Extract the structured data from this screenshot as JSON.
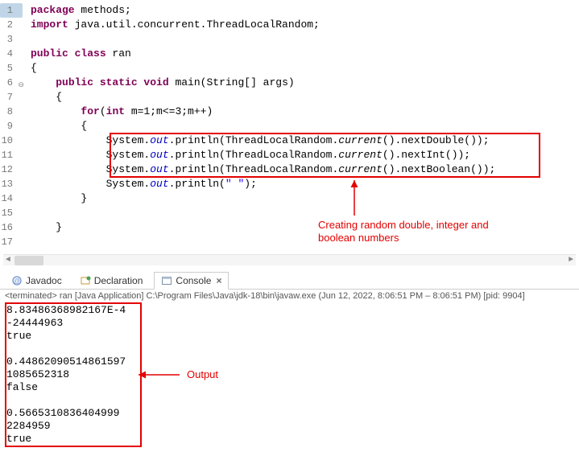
{
  "editor": {
    "lines": [
      {
        "num": "1",
        "tokens": [
          {
            "t": "package",
            "c": "kw"
          },
          {
            "t": " methods;",
            "c": ""
          }
        ]
      },
      {
        "num": "2",
        "tokens": [
          {
            "t": "import",
            "c": "kw"
          },
          {
            "t": " java.util.concurrent.ThreadLocalRandom;",
            "c": ""
          }
        ]
      },
      {
        "num": "3",
        "tokens": []
      },
      {
        "num": "4",
        "tokens": [
          {
            "t": "public class",
            "c": "kw"
          },
          {
            "t": " ran",
            "c": ""
          }
        ]
      },
      {
        "num": "5",
        "tokens": [
          {
            "t": "{",
            "c": ""
          }
        ]
      },
      {
        "num": "6",
        "fold": true,
        "tokens": [
          {
            "t": "    ",
            "c": ""
          },
          {
            "t": "public static void",
            "c": "kw"
          },
          {
            "t": " main(String[] args)",
            "c": ""
          }
        ]
      },
      {
        "num": "7",
        "tokens": [
          {
            "t": "    {",
            "c": ""
          }
        ]
      },
      {
        "num": "8",
        "tokens": [
          {
            "t": "        ",
            "c": ""
          },
          {
            "t": "for",
            "c": "kw"
          },
          {
            "t": "(",
            "c": ""
          },
          {
            "t": "int",
            "c": "kw"
          },
          {
            "t": " m=1;m<=3;m++)",
            "c": ""
          }
        ]
      },
      {
        "num": "9",
        "tokens": [
          {
            "t": "        {",
            "c": ""
          }
        ]
      },
      {
        "num": "10",
        "tokens": [
          {
            "t": "            System.",
            "c": ""
          },
          {
            "t": "out",
            "c": "field"
          },
          {
            "t": ".println(ThreadLocalRandom.",
            "c": ""
          },
          {
            "t": "current",
            "c": "static-call"
          },
          {
            "t": "().nextDouble());",
            "c": ""
          }
        ]
      },
      {
        "num": "11",
        "tokens": [
          {
            "t": "            System.",
            "c": ""
          },
          {
            "t": "out",
            "c": "field"
          },
          {
            "t": ".println(ThreadLocalRandom.",
            "c": ""
          },
          {
            "t": "current",
            "c": "static-call"
          },
          {
            "t": "().nextInt());",
            "c": ""
          }
        ]
      },
      {
        "num": "12",
        "tokens": [
          {
            "t": "            System.",
            "c": ""
          },
          {
            "t": "out",
            "c": "field"
          },
          {
            "t": ".println(ThreadLocalRandom.",
            "c": ""
          },
          {
            "t": "current",
            "c": "static-call"
          },
          {
            "t": "().nextBoolean());",
            "c": ""
          }
        ]
      },
      {
        "num": "13",
        "tokens": [
          {
            "t": "            System.",
            "c": ""
          },
          {
            "t": "out",
            "c": "field"
          },
          {
            "t": ".println(",
            "c": ""
          },
          {
            "t": "\" \"",
            "c": "str"
          },
          {
            "t": ");",
            "c": ""
          }
        ]
      },
      {
        "num": "14",
        "tokens": [
          {
            "t": "        }",
            "c": ""
          }
        ]
      },
      {
        "num": "15",
        "tokens": []
      },
      {
        "num": "16",
        "tokens": [
          {
            "t": "    }",
            "c": ""
          }
        ]
      },
      {
        "num": "17",
        "tokens": []
      }
    ],
    "annotation": "Creating random double, integer and\nboolean numbers"
  },
  "tabs": {
    "javadoc": "Javadoc",
    "declaration": "Declaration",
    "console": "Console"
  },
  "run_info": "<terminated> ran [Java Application] C:\\Program Files\\Java\\jdk-18\\bin\\javaw.exe  (Jun 12, 2022, 8:06:51 PM – 8:06:51 PM) [pid: 9904]",
  "console": {
    "lines": [
      "8.83486368982167E-4",
      "-24444963",
      "true",
      " ",
      "0.44862090514861597",
      "1085652318",
      "false",
      " ",
      "0.5665310836404999",
      "2284959",
      "true"
    ],
    "annotation": "Output"
  }
}
